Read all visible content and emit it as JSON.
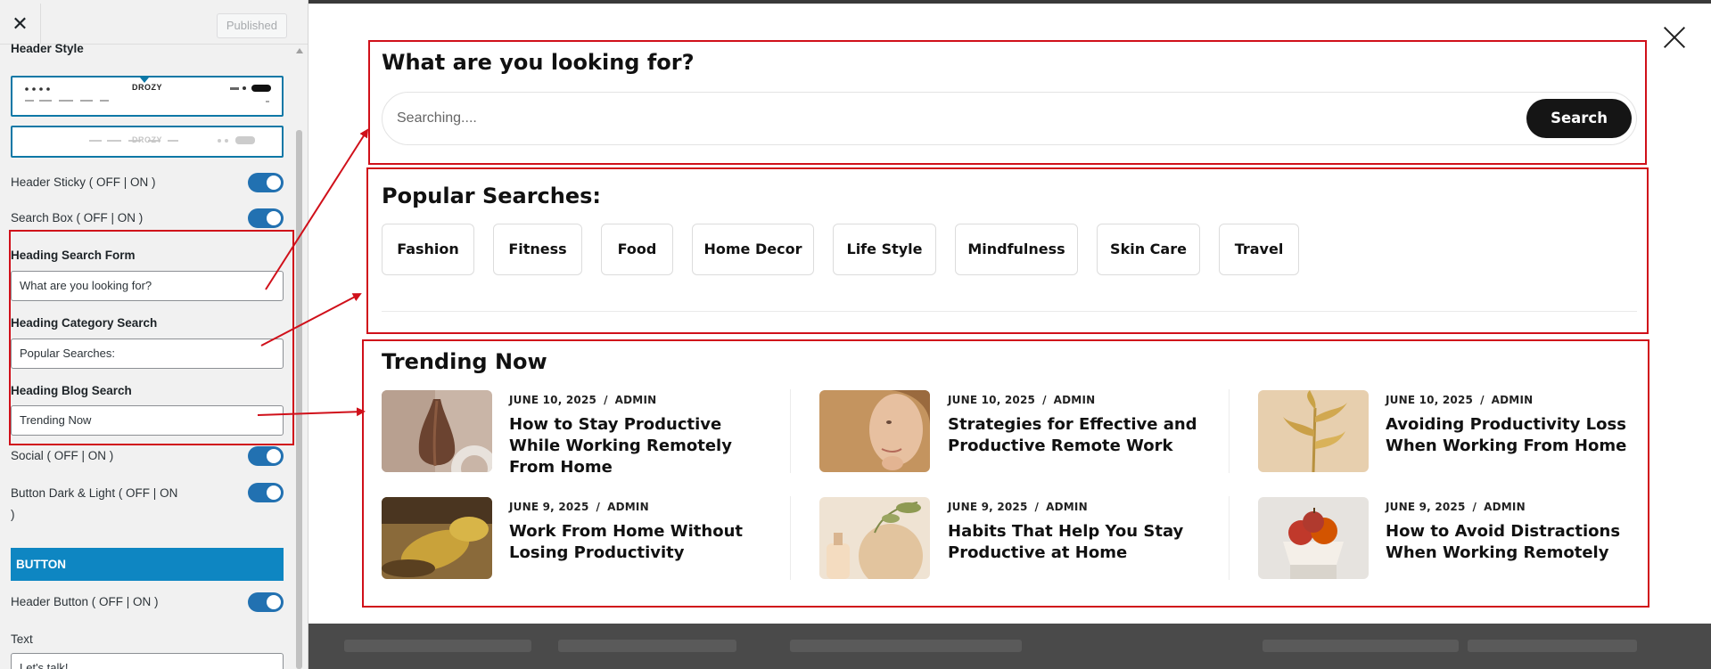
{
  "sidebar": {
    "close_icon": "close-icon",
    "published_label": "Published",
    "header_style_label": "Header Style",
    "style1_logo": "DROZY",
    "style2_logo": "DROZY",
    "header_sticky_label": "Header Sticky ( OFF | ON )",
    "search_box_label": "Search Box ( OFF | ON )",
    "heading_search_form_label": "Heading Search Form",
    "heading_search_form_value": "What are you looking for?",
    "heading_category_search_label": "Heading Category Search",
    "heading_category_search_value": "Popular Searches:",
    "heading_blog_search_label": "Heading Blog Search",
    "heading_blog_search_value": "Trending Now",
    "social_label": "Social ( OFF | ON )",
    "button_dark_light_label": "Button Dark & Light ( OFF | ON",
    "button_dark_light_label_cont": ")",
    "button_section_title": "BUTTON",
    "header_button_label": "Header Button ( OFF | ON )",
    "text_label": "Text",
    "text_value": "Let's talk!",
    "toggles": {
      "header_sticky": true,
      "search_box": true,
      "social": true,
      "button_dark_light": true,
      "header_button": true
    }
  },
  "preview": {
    "close_icon": "close-icon",
    "search_heading": "What are you looking for?",
    "search_placeholder": "Searching....",
    "search_button": "Search",
    "popular_heading": "Popular Searches:",
    "categories": [
      "Fashion",
      "Fitness",
      "Food",
      "Home Decor",
      "Life Style",
      "Mindfulness",
      "Skin Care",
      "Travel"
    ],
    "trending_heading": "Trending Now",
    "posts": [
      {
        "date": "JUNE 10, 2025",
        "author": "ADMIN",
        "title": "How to Stay Productive While Working Remotely From Home"
      },
      {
        "date": "JUNE 10, 2025",
        "author": "ADMIN",
        "title": "Strategies for Effective and Productive Remote Work"
      },
      {
        "date": "JUNE 10, 2025",
        "author": "ADMIN",
        "title": "Avoiding Productivity Loss When Working From Home"
      },
      {
        "date": "JUNE 9, 2025",
        "author": "ADMIN",
        "title": "Work From Home Without Losing Productivity"
      },
      {
        "date": "JUNE 9, 2025",
        "author": "ADMIN",
        "title": "Habits That Help You Stay Productive at Home"
      },
      {
        "date": "JUNE 9, 2025",
        "author": "ADMIN",
        "title": "How to Avoid Distractions When Working Remotely"
      }
    ],
    "meta_separator": "/"
  },
  "colors": {
    "annotation_red": "#d0101a",
    "customizer_blue": "#0e86c2",
    "toggle_blue": "#2271b1",
    "search_button_bg": "#151515"
  }
}
